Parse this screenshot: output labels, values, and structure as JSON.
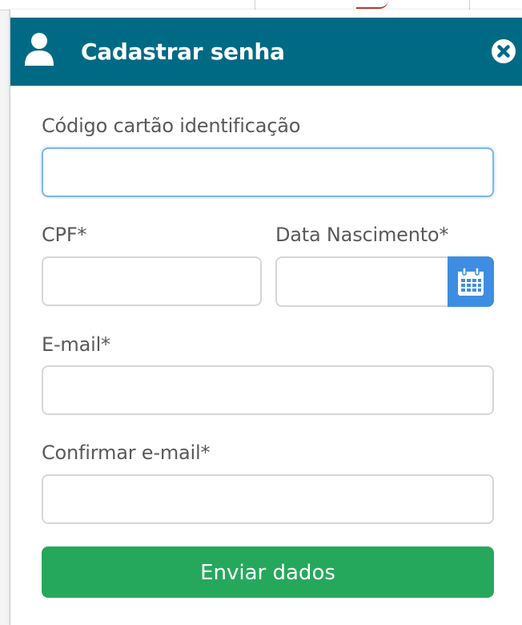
{
  "dialog": {
    "title": "Cadastrar senha",
    "header_icon": "user-icon",
    "close_icon": "close-icon",
    "colors": {
      "header_bg": "#006a84",
      "submit_bg": "#26a85c",
      "calendar_button_bg": "#3d8ee0"
    }
  },
  "form": {
    "codigo": {
      "label": "Código cartão identificação",
      "value": ""
    },
    "cpf": {
      "label": "CPF*",
      "value": ""
    },
    "nascimento": {
      "label": "Data Nascimento*",
      "value": "",
      "button_icon": "calendar-icon"
    },
    "email": {
      "label": "E-mail*",
      "value": ""
    },
    "confirm_email": {
      "label": "Confirmar e-mail*",
      "value": ""
    },
    "submit_label": "Enviar dados"
  }
}
